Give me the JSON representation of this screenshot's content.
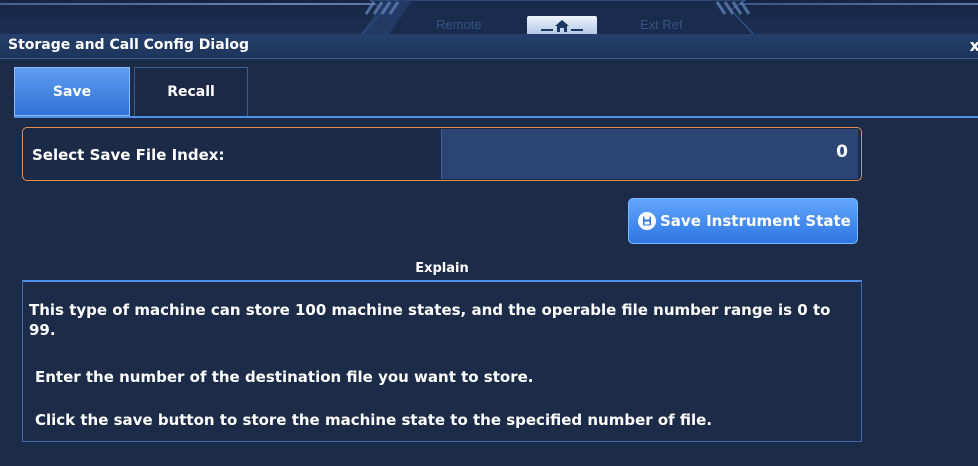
{
  "topbar": {
    "remote_label": "Remote",
    "ext_ref_label": "Ext Ref",
    "home_icon": "home-icon"
  },
  "dialog": {
    "title": "Storage and Call Config Dialog",
    "close_label": "x"
  },
  "tabs": [
    {
      "label": "Save",
      "active": true
    },
    {
      "label": "Recall",
      "active": false
    }
  ],
  "save": {
    "index_label": "Select Save File Index:",
    "index_value": "0",
    "button_label": "Save Instrument State",
    "button_icon": "floppy-disk-icon"
  },
  "explain": {
    "title": "Explain",
    "paragraphs": [
      "This type of machine can store 100 machine states, and the operable file number range is 0 to 99.",
      "Enter the number of the destination file you want to store.",
      "Click the save button to store the machine state to the specified number of file."
    ]
  },
  "colors": {
    "background": "#1c2b48",
    "accent": "#4d8ee8",
    "field_border": "#e58e4a",
    "value_box": "#2c4474"
  }
}
